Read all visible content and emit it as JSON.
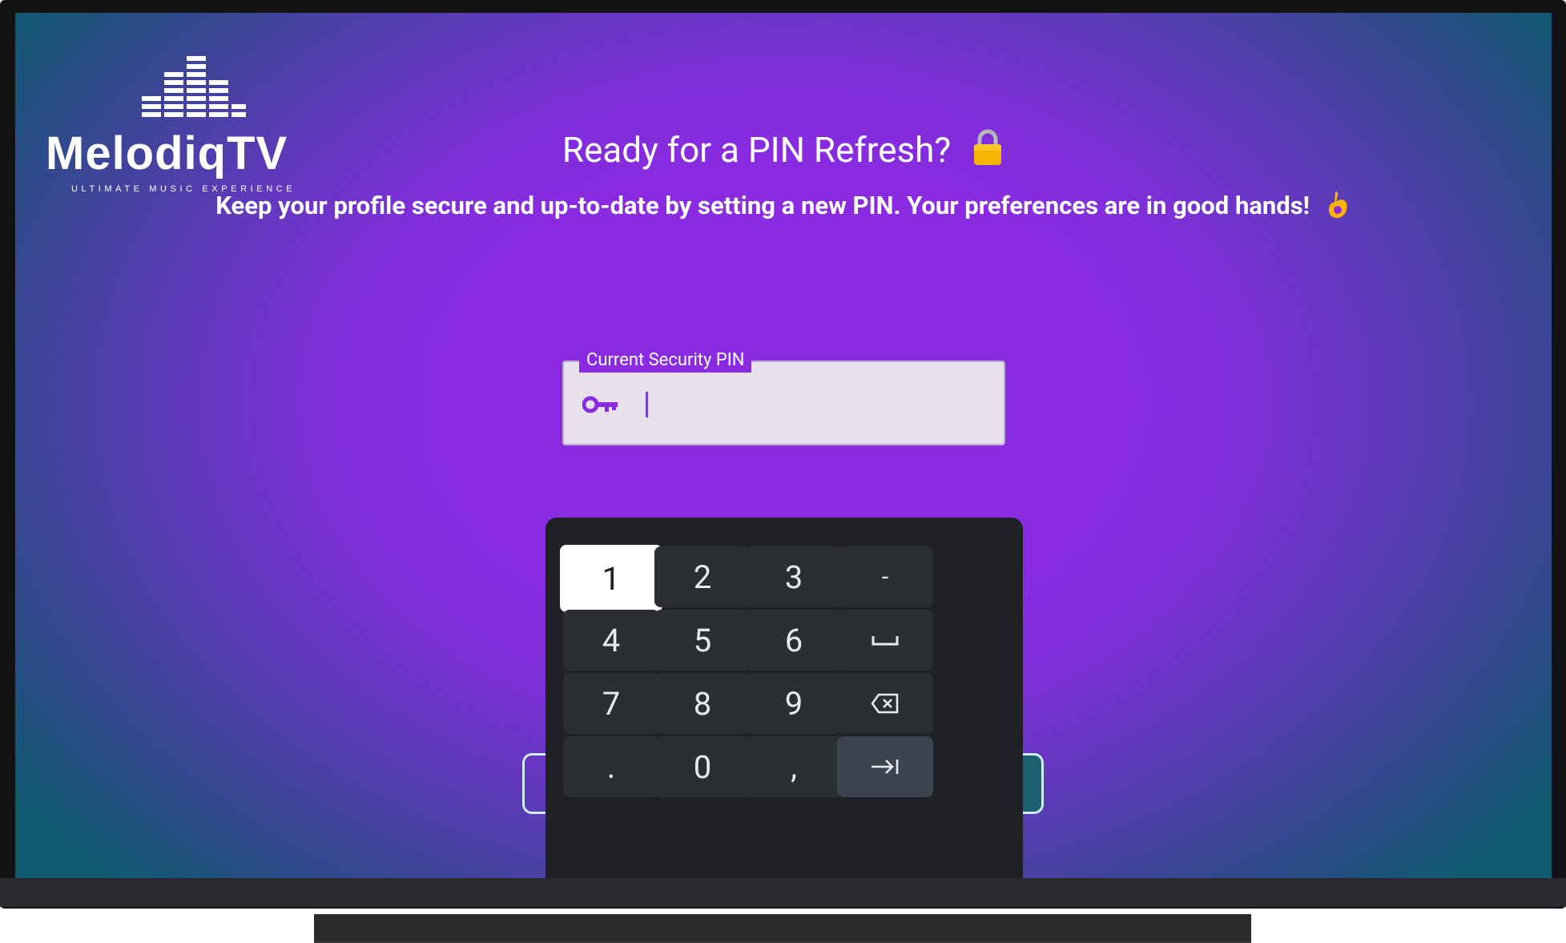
{
  "brand": {
    "name": "MelodiqTV",
    "tagline": "ULTIMATE MUSIC EXPERIENCE"
  },
  "header": {
    "title": "Ready for a PIN Refresh?",
    "title_icon": "lock-emoji-icon",
    "subtitle": "Keep your profile secure and up-to-date by setting a new PIN. Your preferences are in good hands!",
    "subtitle_icon": "ok-hand-emoji-icon"
  },
  "pin_field": {
    "label": "Current Security PIN",
    "value": "",
    "icon": "key-icon"
  },
  "keypad": {
    "focused_key": "1",
    "rows": [
      [
        "1",
        "2",
        "3",
        "-"
      ],
      [
        "4",
        "5",
        "6",
        "space"
      ],
      [
        "7",
        "8",
        "9",
        "backspace"
      ],
      [
        ".",
        "0",
        ",",
        "next"
      ]
    ],
    "labels": {
      "k1": "1",
      "k2": "2",
      "k3": "3",
      "kdash": "-",
      "k4": "4",
      "k5": "5",
      "k6": "6",
      "k7": "7",
      "k8": "8",
      "k9": "9",
      "kdot": ".",
      "k0": "0",
      "kcomma": ","
    }
  },
  "colors": {
    "background_center": "#8a2be2",
    "background_edge": "#0e5a6e",
    "keypad_bg": "#202124",
    "key_bg": "#2b2f34",
    "key_focus_bg": "#ffffff",
    "field_bg": "#e6e0ea",
    "accent": "#7b3fd0"
  }
}
